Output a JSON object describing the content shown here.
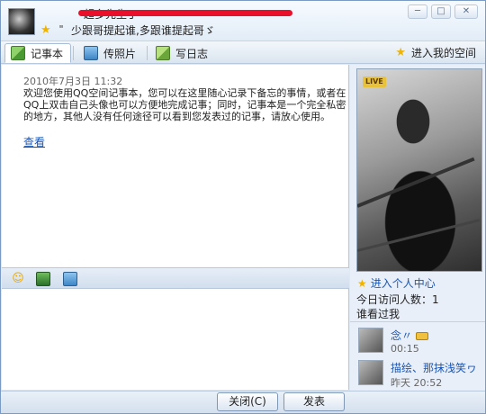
{
  "header": {
    "nickname": "超多先生丁",
    "signature": "少跟哥提起谁,多跟谁提起哥ゞ",
    "window_buttons": {
      "min": "─",
      "max": "□",
      "close": "✕"
    }
  },
  "tabs": [
    {
      "label": "记事本"
    },
    {
      "label": "传照片"
    },
    {
      "label": "写日志"
    }
  ],
  "space_link": "进入我的空间",
  "note": {
    "date": "2010年7月3日  11:32",
    "text": "欢迎您使用QQ空间记事本，您可以在这里随心记录下备忘的事情，或者在QQ上双击自己头像也可以方便地完成记事；同时，记事本是一个完全私密的地方，其他人没有任何途径可以看到您发表过的记事，请放心使用。",
    "view_link": "查看"
  },
  "toolbar": {
    "icons": [
      "emoticon-icon",
      "image-icon",
      "screenshot-icon"
    ]
  },
  "profile": {
    "live_badge": "LIVE",
    "personal_center": "进入个人中心",
    "visit_count": "今日访问人数：1",
    "who_viewed": "谁看过我"
  },
  "visitors": [
    {
      "name": "念〃",
      "time": "00:15"
    },
    {
      "name": "描绘、那抹浅笑ヮ",
      "time": "昨天  20:52"
    }
  ],
  "footer": {
    "close_label": "关闭(C)",
    "publish_label": "发表"
  }
}
